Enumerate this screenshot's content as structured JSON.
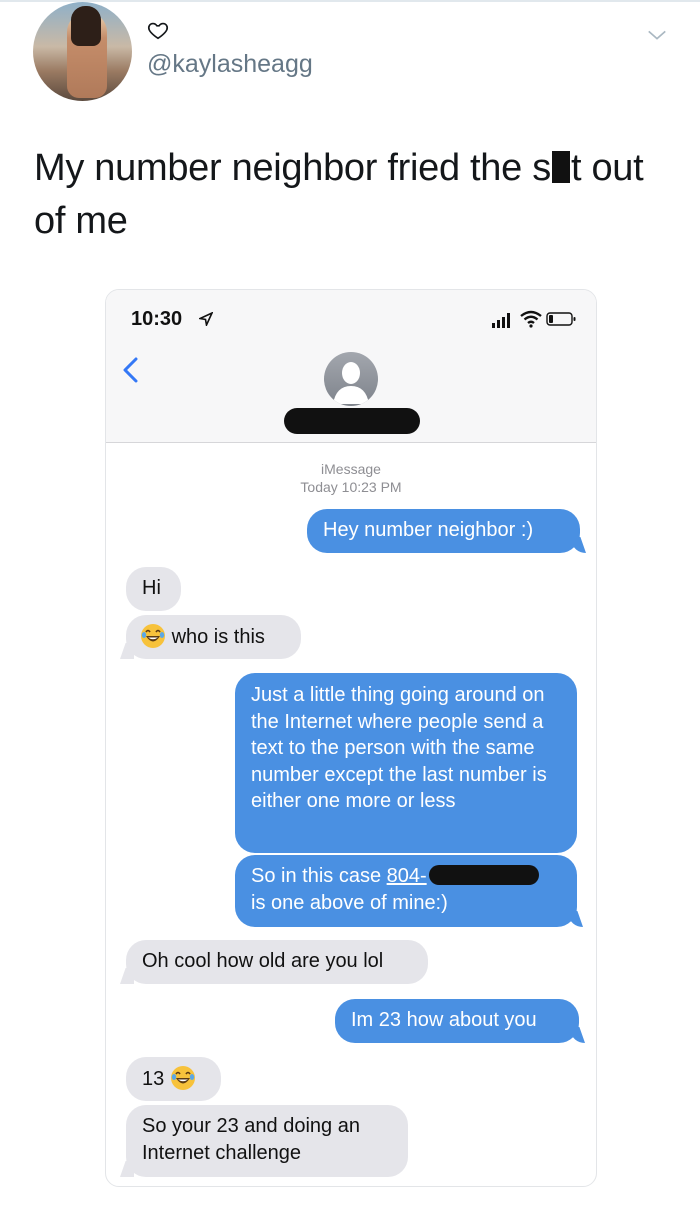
{
  "tweet": {
    "handle": "@kaylasheagg",
    "text_part1": "My number neighbor fried the s",
    "text_part2": "t out of me"
  },
  "screenshot": {
    "status_bar": {
      "time": "10:30"
    },
    "thread_header": {
      "service": "iMessage",
      "timestamp": "Today 10:23 PM"
    },
    "messages": [
      {
        "from": "me",
        "text": "Hey number neighbor :)"
      },
      {
        "from": "them",
        "text": "Hi"
      },
      {
        "from": "them",
        "emoji": "laughing-face",
        "text": "who is this"
      },
      {
        "from": "me",
        "text": "Just a little thing going around on the Internet where people send a text to the person with the same number except the last number is either one more or less"
      },
      {
        "from": "me",
        "text_before": "So in this case ",
        "link_prefix": "804-",
        "text_after": "is one above of mine:)"
      },
      {
        "from": "them",
        "text": "Oh cool how old are you lol"
      },
      {
        "from": "me",
        "text": "Im 23 how about you"
      },
      {
        "from": "them",
        "text": "13",
        "emoji": "laughing-face"
      },
      {
        "from": "them",
        "text": "So your 23 and doing an Internet challenge"
      }
    ]
  },
  "colors": {
    "outgoing": "#4a90e2",
    "incoming": "#e5e5ea",
    "ios_blue": "#3478f6"
  }
}
